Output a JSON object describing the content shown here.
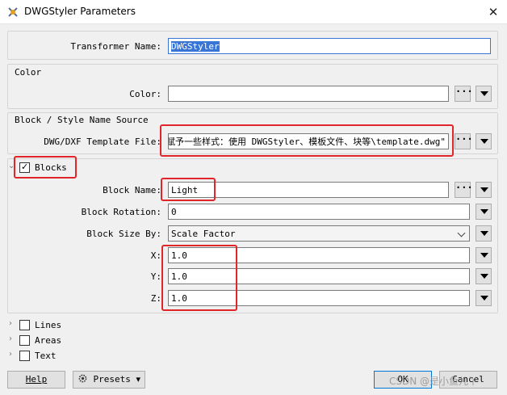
{
  "window": {
    "title": "DWGStyler Parameters",
    "close_glyph": "✕"
  },
  "transformer": {
    "label": "Transformer Name:",
    "value": "DWGStyler"
  },
  "color_group": {
    "title": "Color",
    "label": "Color:",
    "value": ""
  },
  "source_group": {
    "title": "Block / Style Name Source",
    "label": "DWG/DXF Template File:",
    "value": "赋予一些样式：使用 DWGStyler、模板文件、块等\\template.dwg\""
  },
  "blocks": {
    "title": "Blocks",
    "checked": true,
    "name_label": "Block Name:",
    "name_value": "Light",
    "rotation_label": "Block Rotation:",
    "rotation_value": "0",
    "size_label": "Block Size By:",
    "size_value": "Scale Factor",
    "x_label": "X:",
    "x_value": "1.0",
    "y_label": "Y:",
    "y_value": "1.0",
    "z_label": "Z:",
    "z_value": "1.0"
  },
  "sections": [
    {
      "label": "Lines"
    },
    {
      "label": "Areas"
    },
    {
      "label": "Text"
    }
  ],
  "footer": {
    "help": "Help",
    "presets": "Presets",
    "ok": "OK",
    "cancel": "Cancel",
    "watermark": "CSDN @是小鱼儿丫"
  },
  "glyphs": {
    "ellipsis": "···",
    "check": "✓",
    "caret_right": "›",
    "caret_down": "⌄",
    "presets_arrow": "▾"
  },
  "icons": [
    "app-icon",
    "close-icon",
    "ellipsis-icon",
    "dropdown-arrow-icon",
    "gear-icon",
    "chevron-right-icon",
    "chevron-down-icon",
    "checkbox-icon"
  ],
  "colors": {
    "highlight": "#e0262b",
    "selection": "#3875d7",
    "window_bg": "#f0f0f0"
  }
}
